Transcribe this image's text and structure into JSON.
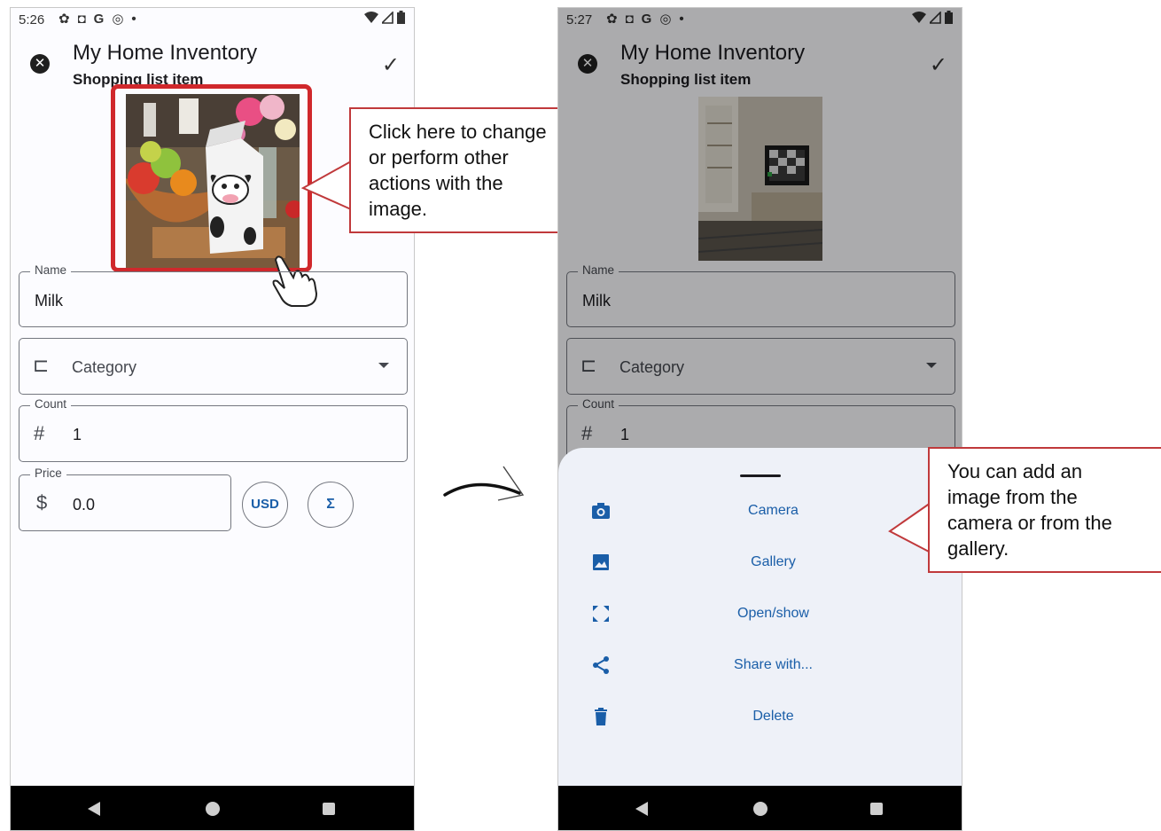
{
  "left_phone": {
    "status": {
      "time": "5:26",
      "icons": [
        "gear-icon",
        "a-icon",
        "G",
        "at-icon",
        "•"
      ]
    },
    "appbar": {
      "title": "My Home Inventory",
      "subtitle": "Shopping list item"
    },
    "fields": {
      "name": {
        "label": "Name",
        "value": "Milk"
      },
      "category": {
        "placeholder": "Category"
      },
      "count": {
        "label": "Count",
        "value": "1"
      },
      "price": {
        "label": "Price",
        "value": "0.0"
      }
    },
    "buttons": {
      "currency": "USD",
      "sum": "Σ"
    }
  },
  "right_phone": {
    "status": {
      "time": "5:27",
      "icons": [
        "gear-icon",
        "a-icon",
        "G",
        "at-icon",
        "•"
      ]
    },
    "appbar": {
      "title": "My Home Inventory",
      "subtitle": "Shopping list item"
    },
    "fields": {
      "name": {
        "label": "Name",
        "value": "Milk"
      },
      "category": {
        "placeholder": "Category"
      },
      "count": {
        "label": "Count",
        "value": "1"
      }
    },
    "sheet": {
      "items": [
        {
          "label": "Camera",
          "icon": "camera-icon"
        },
        {
          "label": "Gallery",
          "icon": "image-icon"
        },
        {
          "label": "Open/show",
          "icon": "fullscreen-icon"
        },
        {
          "label": "Share with...",
          "icon": "share-icon"
        },
        {
          "label": "Delete",
          "icon": "trash-icon"
        }
      ]
    }
  },
  "callouts": {
    "left": [
      "Click here to change",
      "or perform other",
      "actions with the",
      "image."
    ],
    "right": [
      "You can add an",
      "image from the",
      "camera or from the",
      "gallery."
    ]
  },
  "colors": {
    "accent": "#1a5ea8",
    "callout_border": "#c0393b",
    "highlight": "#d0282c"
  }
}
